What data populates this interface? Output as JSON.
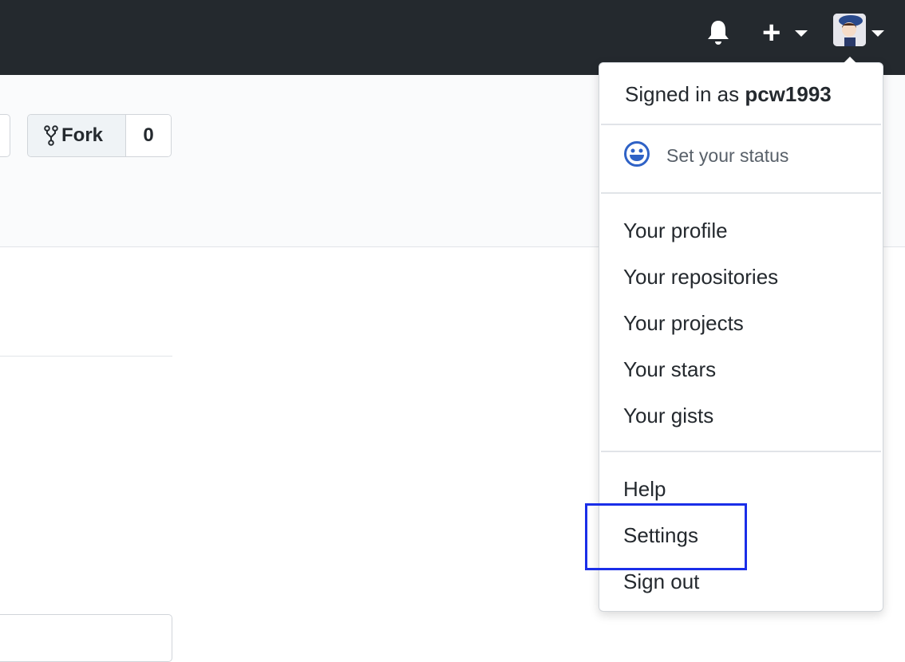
{
  "header": {
    "icons": [
      "bell-icon",
      "plus-icon",
      "avatar"
    ]
  },
  "repo": {
    "fork_label": "Fork",
    "fork_count": "0"
  },
  "dropdown": {
    "signed_in_prefix": "Signed in as ",
    "username": "pcw1993",
    "status_label": "Set your status",
    "items_group1": [
      "Your profile",
      "Your repositories",
      "Your projects",
      "Your stars",
      "Your gists"
    ],
    "items_group2": [
      "Help",
      "Settings",
      "Sign out"
    ]
  },
  "highlight_color": "#1a2ee8"
}
